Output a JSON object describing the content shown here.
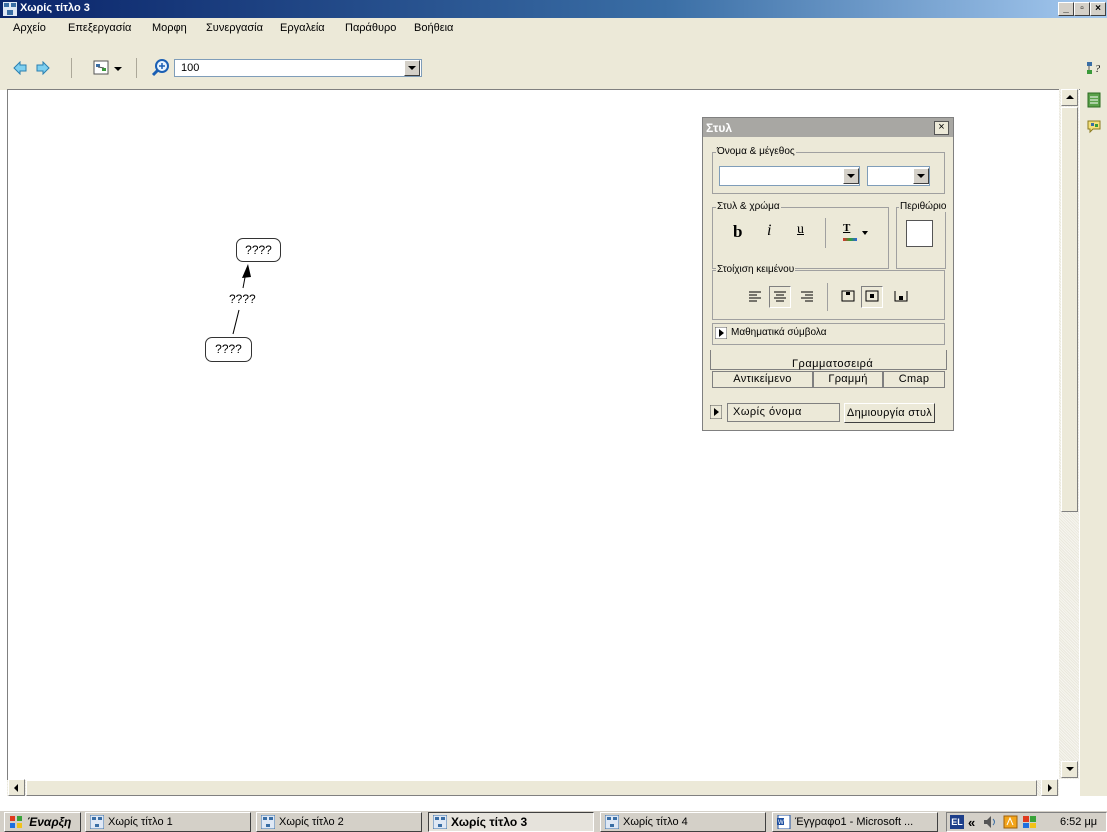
{
  "window": {
    "title": "Χωρίς τίτλο 3",
    "controls": [
      "_",
      "▫",
      "×"
    ]
  },
  "menu": [
    "Αρχείο",
    "Επεξεργασία",
    "Μορφη",
    "Συνεργασία",
    "Εργαλεία",
    "Παράθυρο",
    "Βοήθεια"
  ],
  "toolbar": {
    "zoom_value": "100"
  },
  "concepts": [
    {
      "label": "????"
    },
    {
      "label": "????"
    }
  ],
  "link_label": "????",
  "style_panel": {
    "title": "Στυλ",
    "close": "×",
    "font_group": "Όνομα & μέγεθος",
    "style_group": "Στυλ & χρώμα",
    "margin_group": "Περιθώριο",
    "bold": "b",
    "italic": "i",
    "underline": "u",
    "color_t": "T",
    "align_group": "Στοίχιση κειμένου",
    "math_symbols": "Μαθηματικά σύμβολα",
    "tabs": {
      "font": "Γραμματοσειρά",
      "object": "Αντικείμενο",
      "line": "Γραμμή",
      "cmap": "Cmap"
    },
    "style_name": "Χωρίς όνομα",
    "create_style": "Δημιουργία στυλ"
  },
  "taskbar": {
    "start": "Έναρξη",
    "tasks": [
      "Χωρίς τίτλο 1",
      "Χωρίς τίτλο 2",
      "Χωρίς τίτλο 3",
      "Χωρίς τίτλο 4",
      "Έγγραφο1 - Microsoft ..."
    ],
    "lang": "EL",
    "chevron": "«",
    "clock": "6:52 μμ"
  }
}
